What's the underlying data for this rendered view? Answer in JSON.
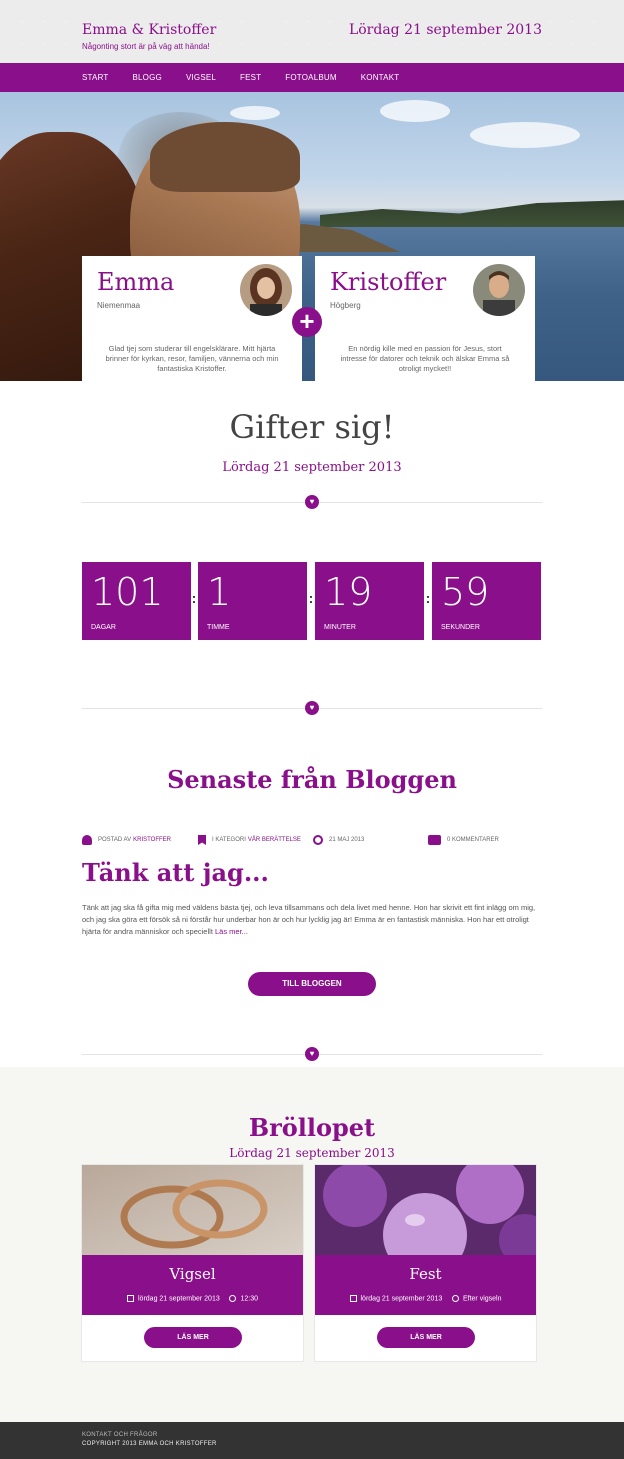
{
  "colors": {
    "accent": "#8a0f8a",
    "footer": "#333333",
    "section_bg": "#f6f6f2"
  },
  "header": {
    "brand": "Emma & Kristoffer",
    "tagline": "Någonting stort är på väg att hända!",
    "date": "Lördag 21 september 2013"
  },
  "nav": {
    "items": [
      {
        "label": "START"
      },
      {
        "label": "BLOGG"
      },
      {
        "label": "VIGSEL"
      },
      {
        "label": "FEST"
      },
      {
        "label": "FOTOALBUM"
      },
      {
        "label": "KONTAKT"
      }
    ]
  },
  "couple": {
    "bride": {
      "first": "Emma",
      "last": "Niemenmaa",
      "desc": "Glad tjej som studerar till engelsklärare. Mitt hjärta brinner för kyrkan, resor, familjen, vännerna och min fantastiska Kristoffer."
    },
    "groom": {
      "first": "Kristoffer",
      "last": "Högberg",
      "desc": "En nördig kille med en passion för Jesus, stort intresse för datorer och teknik och älskar Emma så otroligt mycket!!"
    },
    "plus_icon": "plus-icon"
  },
  "married": {
    "title": "Gifter sig!",
    "date": "Lördag 21 september 2013"
  },
  "countdown": [
    {
      "value": "101",
      "unit": "DAGAR"
    },
    {
      "value": "1",
      "unit": "TIMME"
    },
    {
      "value": "19",
      "unit": "MINUTER"
    },
    {
      "value": "59",
      "unit": "SEKUNDER"
    }
  ],
  "blog": {
    "section_title": "Senaste från Bloggen",
    "meta": {
      "posted_by_label": "POSTAD AV",
      "author": "KRISTOFFER",
      "category_label": "I KATEGORI",
      "category": "VÅR BERÄTTELSE",
      "date": "21 MAJ 2013",
      "comments": "0 KOMMENTARER"
    },
    "post_title": "Tänk att jag...",
    "excerpt": "Tänk att jag ska få gifta mig med väldens bästa tjej, och leva tillsammans och dela livet med henne. Hon har skrivit ett fint inlägg om mig, och jag ska göra ett försök så ni förstår hur underbar hon är och hur lycklig jag är! Emma är en fantastisk människa. Hon har ett otroligt hjärta för andra människor och speciellt",
    "read_more": "Läs mer...",
    "button": "TILL BLOGGEN"
  },
  "wedding": {
    "title": "Bröllopet",
    "date": "Lördag 21 september 2013",
    "cards": [
      {
        "title": "Vigsel",
        "date": "lördag 21 september 2013",
        "time": "12:30",
        "button": "LÄS MER"
      },
      {
        "title": "Fest",
        "date": "lördag 21 september 2013",
        "time": "Efter vigseln",
        "button": "LÄS MER"
      }
    ]
  },
  "footer": {
    "line1": "KONTAKT OCH FRÅGOR",
    "line2": "COPYRIGHT 2013 EMMA OCH KRISTOFFER"
  }
}
